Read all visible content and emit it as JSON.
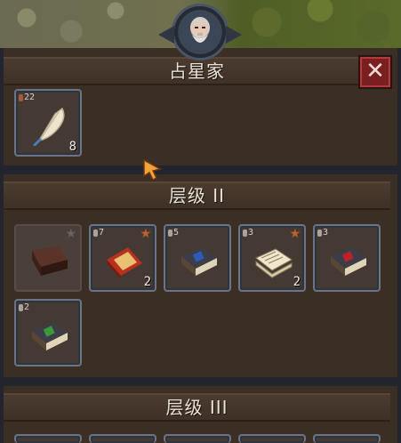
{
  "window": {
    "title": "占星家",
    "close_label": "✕"
  },
  "sections": [
    {
      "header": "",
      "slots": [
        {
          "name": "feather",
          "level": "22",
          "count": "8",
          "icon": "feather-quill-icon",
          "starred": false
        }
      ]
    },
    {
      "header": "层级 II",
      "slots": [
        {
          "name": "locked-book",
          "level": "",
          "count": "",
          "icon": "brown-book-icon",
          "starred": true,
          "locked": true
        },
        {
          "name": "red-book-open",
          "level": "7",
          "count": "2",
          "icon": "red-open-book-icon",
          "starred": true
        },
        {
          "name": "blue-gem-book",
          "level": "5",
          "count": "",
          "icon": "blue-gem-book-icon",
          "starred": false
        },
        {
          "name": "paper-stack",
          "level": "3",
          "count": "2",
          "icon": "paper-stack-icon",
          "starred": true
        },
        {
          "name": "red-gem-book",
          "level": "3",
          "count": "",
          "icon": "red-gem-book-icon",
          "starred": false
        },
        {
          "name": "green-gem-book",
          "level": "2",
          "count": "",
          "icon": "green-gem-book-icon",
          "starred": false
        }
      ]
    },
    {
      "header": "层级 III",
      "slots": []
    }
  ],
  "colors": {
    "accent_star": "#c06030",
    "close_button": "#7a1f1f",
    "panel_bg": "#3a2e25",
    "frame_border": "#6b7484"
  }
}
